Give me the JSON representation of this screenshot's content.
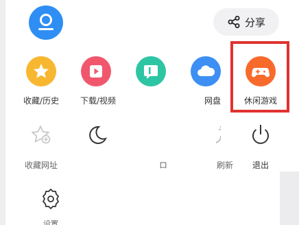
{
  "header": {
    "share_label": "分享"
  },
  "row1": [
    {
      "label": "收藏/历史",
      "color": "#f7b731",
      "icon": "star-icon"
    },
    {
      "label": "下载/视频",
      "color": "#f0576d",
      "icon": "play-icon"
    },
    {
      "label": "",
      "color": "#2ec5a4",
      "icon": "note-icon"
    },
    {
      "label": "网盘",
      "color": "#3d8ff3",
      "icon": "cloud-icon"
    },
    {
      "label": "休闲游戏",
      "color": "#f86a2c",
      "icon": "gamepad-icon"
    }
  ],
  "row2": [
    {
      "label": "收藏网址",
      "icon": "star-add-icon"
    },
    {
      "label": "",
      "icon": "moon-icon"
    },
    {
      "label": "ロ",
      "icon": "blank-icon"
    },
    {
      "label": "刷新",
      "icon": "refresh-icon"
    },
    {
      "label": "退出",
      "icon": "power-icon"
    }
  ],
  "row3": [
    {
      "label": "设置",
      "icon": "gear-icon"
    }
  ],
  "colors": {
    "highlight_border": "#e0322f",
    "avatar": "#2f8ef4"
  }
}
